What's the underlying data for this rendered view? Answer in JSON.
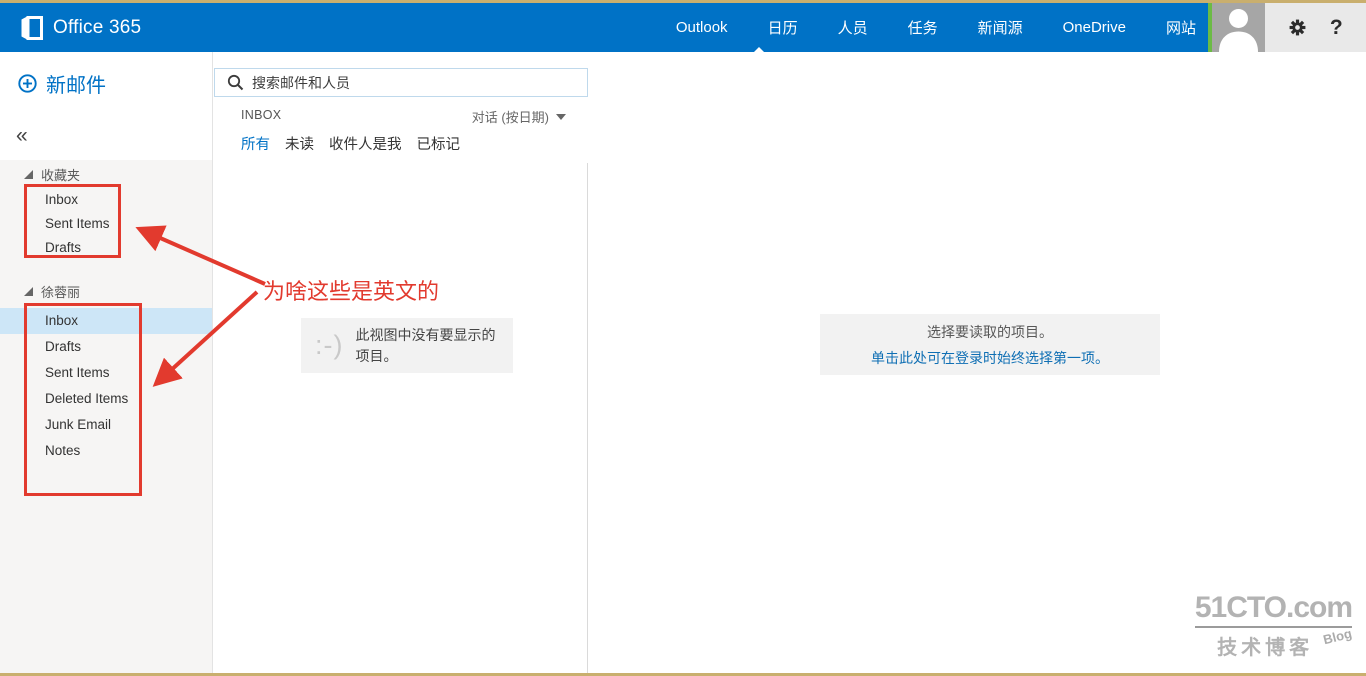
{
  "topbar": {
    "brand": "Office 365",
    "nav": [
      {
        "label": "Outlook",
        "active": true
      },
      {
        "label": "日历"
      },
      {
        "label": "人员"
      },
      {
        "label": "任务"
      },
      {
        "label": "新闻源"
      },
      {
        "label": "OneDrive"
      },
      {
        "label": "网站"
      }
    ],
    "help_glyph": "?"
  },
  "sidebar": {
    "new_mail_label": "新邮件",
    "collapse_glyph": "«",
    "sections": [
      {
        "title": "收藏夹",
        "items": [
          "Inbox",
          "Sent Items",
          "Drafts"
        ]
      },
      {
        "title": "徐蓉丽",
        "items": [
          "Inbox",
          "Drafts",
          "Sent Items",
          "Deleted Items",
          "Junk Email",
          "Notes"
        ],
        "selected_item": "Inbox"
      }
    ]
  },
  "message_list": {
    "search_placeholder": "搜索邮件和人员",
    "folder_label": "INBOX",
    "sort_label": "对话 (按日期)",
    "filters": [
      {
        "label": "所有",
        "active": true
      },
      {
        "label": "未读"
      },
      {
        "label": "收件人是我"
      },
      {
        "label": "已标记"
      }
    ],
    "empty_emoticon": ":-)",
    "empty_text": "此视图中没有要显示的项目。"
  },
  "reading_pane": {
    "prompt": "选择要读取的项目。",
    "link": "单击此处可在登录时始终选择第一项。"
  },
  "annotations": {
    "question_text": "为啥这些是英文的",
    "color": "#E23A2E"
  },
  "watermark": {
    "title": "51CTO.com",
    "subtitle": "技术博客",
    "badge": "Blog"
  },
  "colors": {
    "topbar_blue": "#0072C6",
    "accent_blue": "#0072C6",
    "selected_row": "#CDE6F7",
    "presence_green": "#6CBB45",
    "panel_gray": "#F6F5F4",
    "card_gray": "#F2F2F2",
    "strip_tan": "#C9AF6E"
  }
}
